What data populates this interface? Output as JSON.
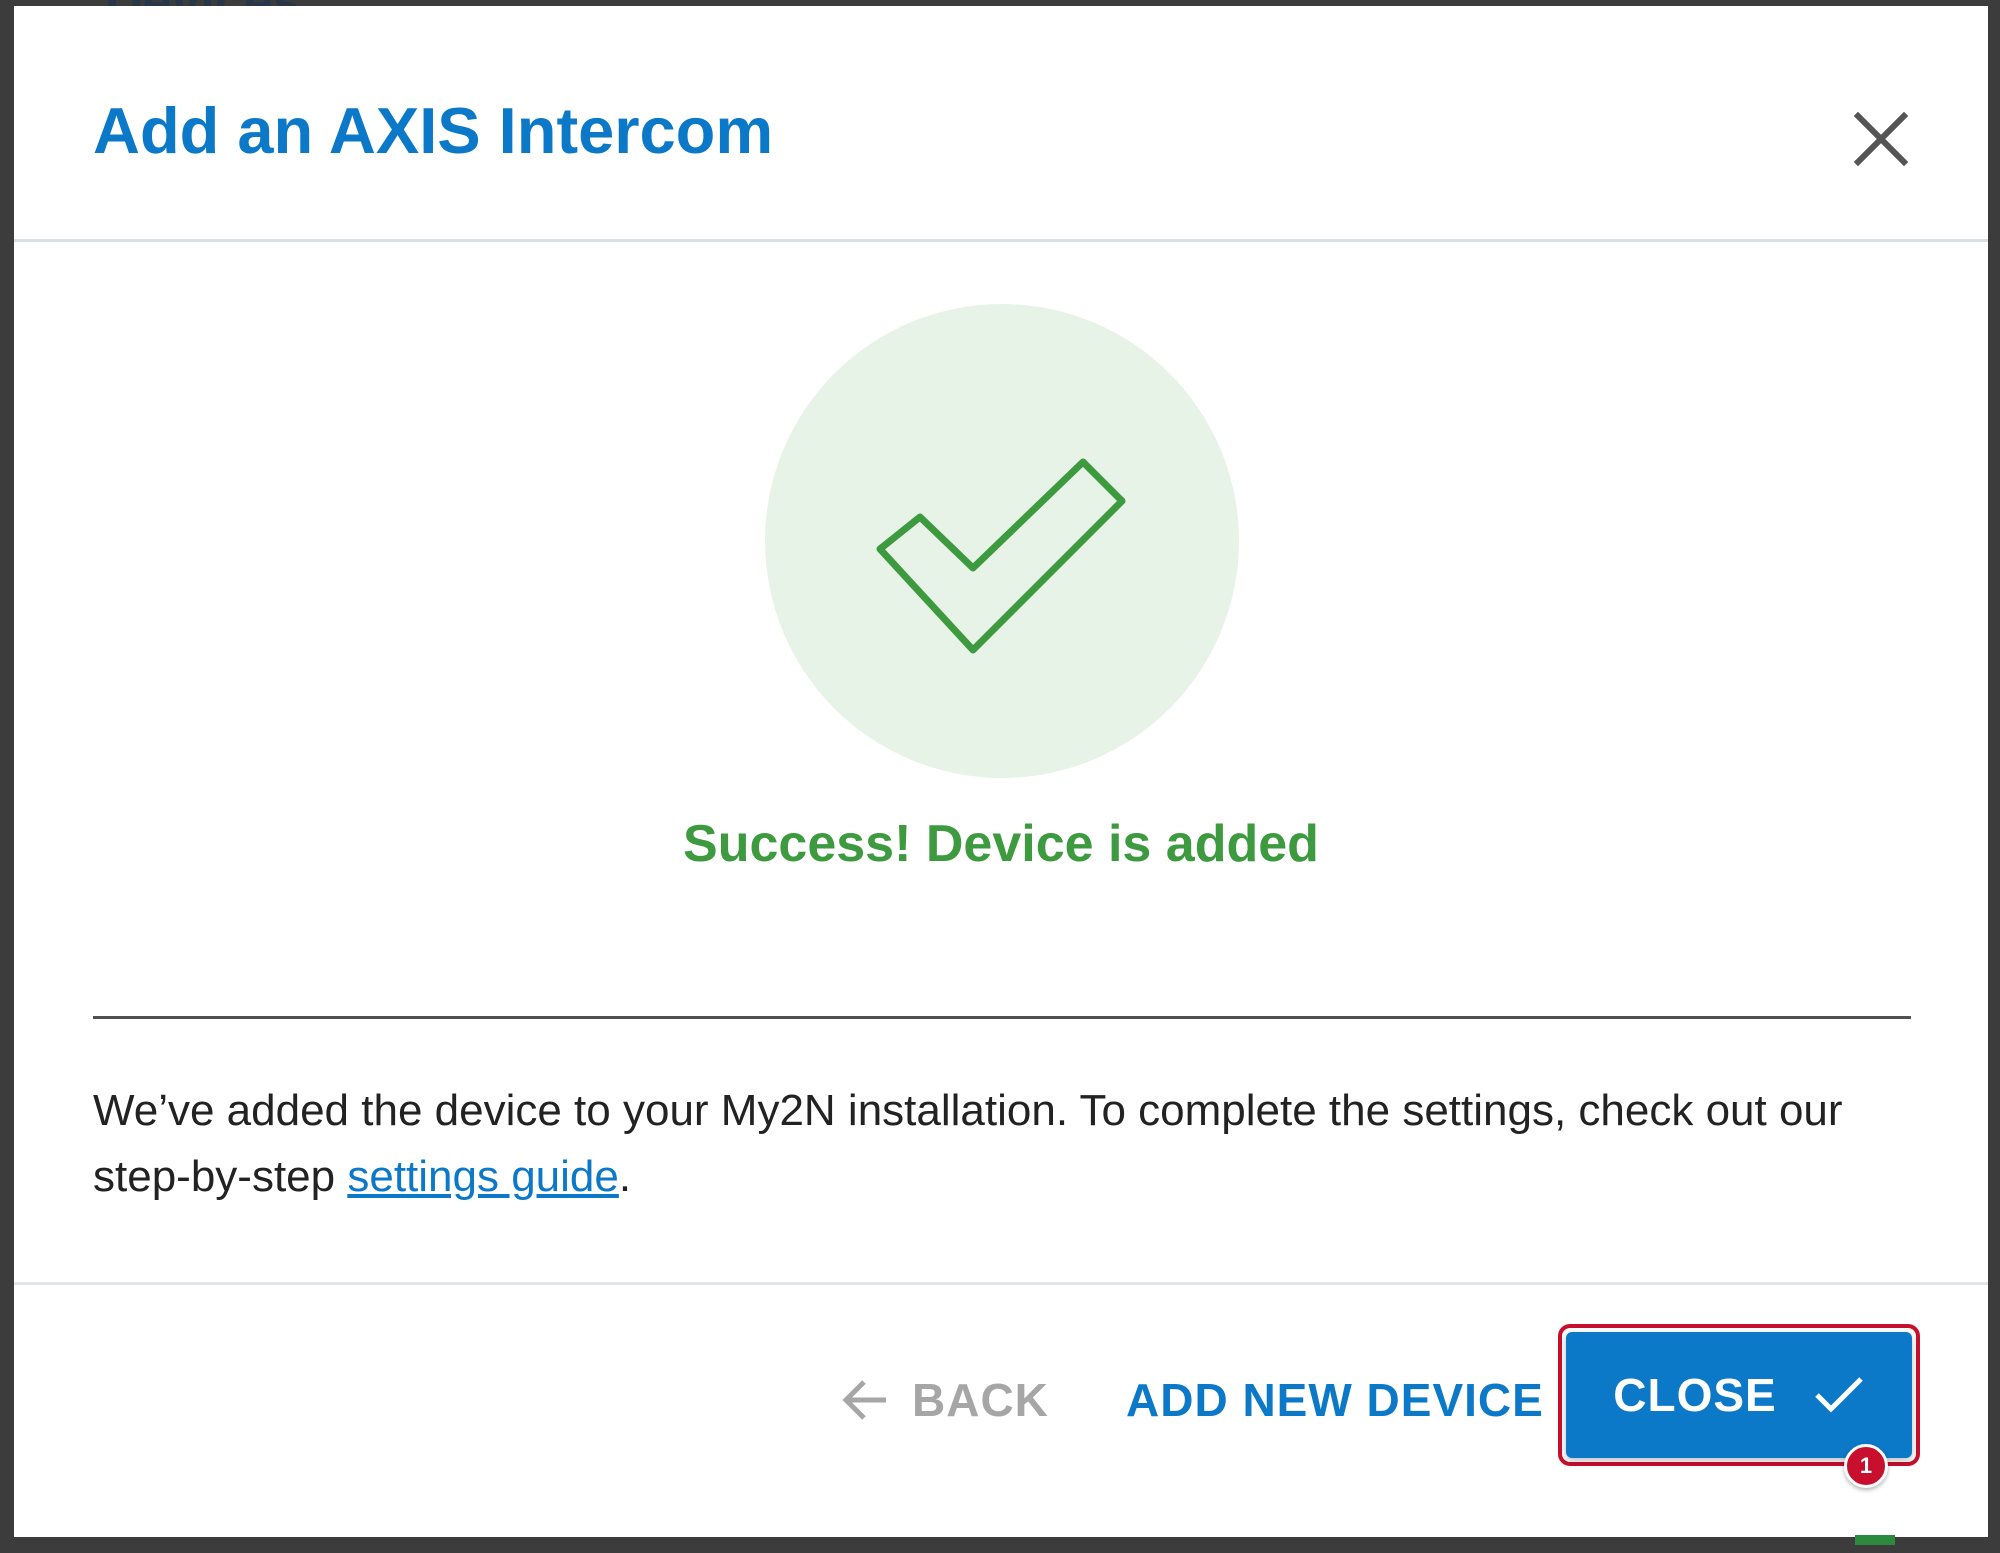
{
  "backdrop": {
    "partial_title": "Devices"
  },
  "dialog": {
    "title": "Add an AXIS Intercom",
    "close_icon": "close-icon"
  },
  "status": {
    "icon": "check-icon",
    "message": "Success! Device is added",
    "color": "#3d9a3f",
    "circle_color": "#e8f3e8"
  },
  "info": {
    "text_before": "We’ve added the device to your My2N installation. To complete the settings, check out our step-by-step ",
    "link_label": "settings guide",
    "text_after": "."
  },
  "footer": {
    "back_label": "BACK",
    "back_icon": "arrow-left-icon",
    "add_new_device_label": "ADD NEW DEVICE",
    "close_label": "CLOSE",
    "close_icon": "check-icon",
    "badge_number": "1"
  },
  "colors": {
    "accent": "#0b78c8",
    "highlight": "#c8102e",
    "disabled": "#a6a6a6"
  }
}
